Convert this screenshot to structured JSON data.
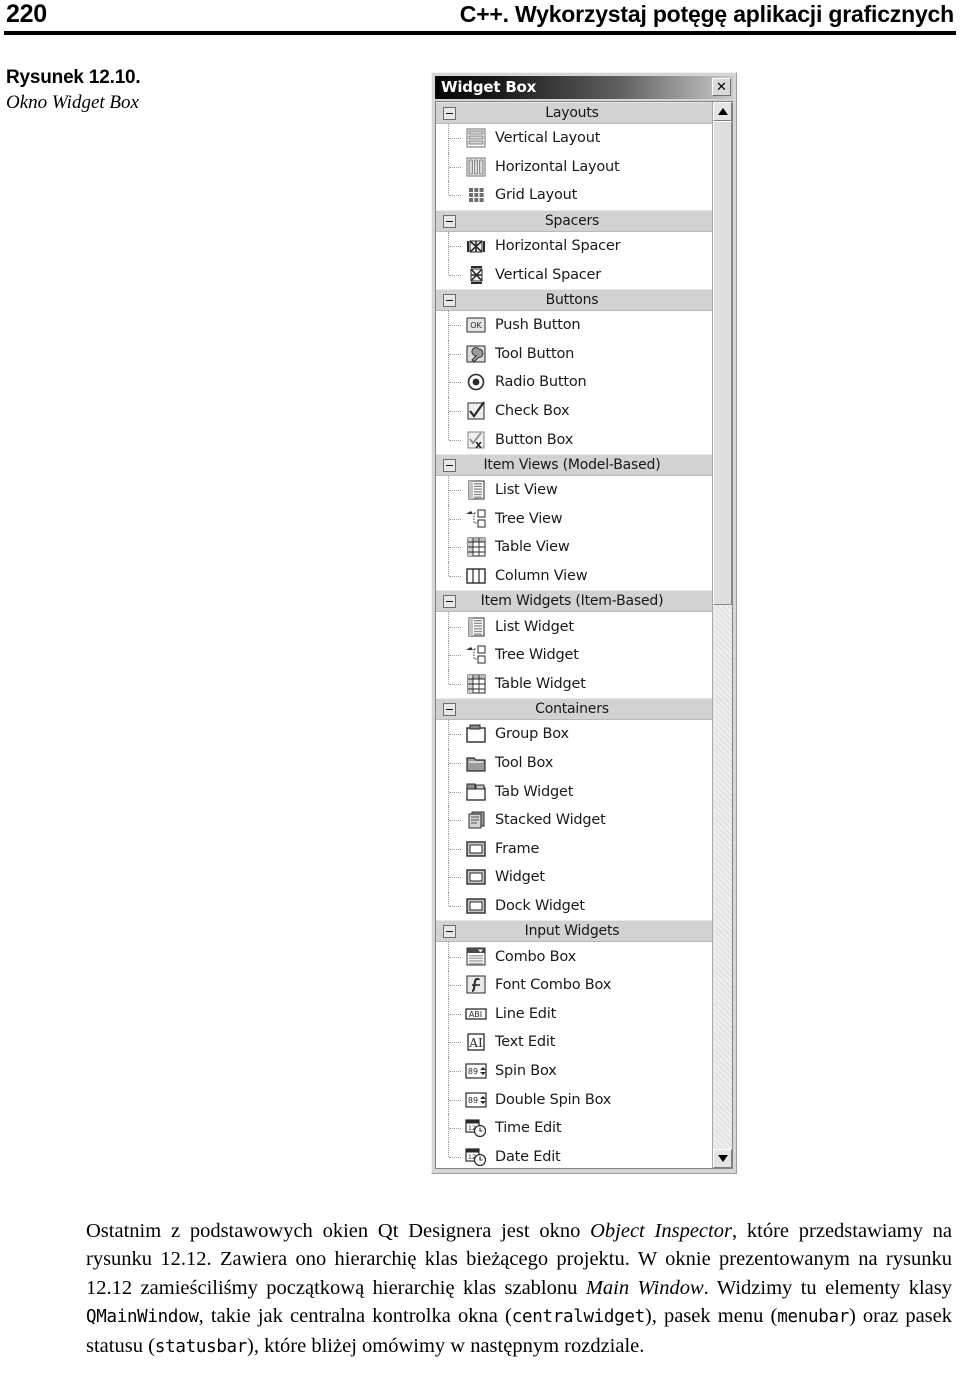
{
  "page": {
    "folio": "220",
    "running_title": "C++. Wykorzystaj potęgę aplikacji graficznych"
  },
  "figure": {
    "number": "Rysunek 12.10.",
    "title": "Okno Widget Box"
  },
  "widget_box": {
    "title": "Widget Box",
    "close_label": "✕",
    "scroll": {
      "up_arrow": "▲",
      "down_arrow": "▼"
    },
    "groups": [
      {
        "label": "Layouts",
        "expanded": true,
        "items": [
          {
            "label": "Vertical Layout",
            "icon": "vertical-layout-icon"
          },
          {
            "label": "Horizontal Layout",
            "icon": "horizontal-layout-icon"
          },
          {
            "label": "Grid Layout",
            "icon": "grid-layout-icon"
          }
        ]
      },
      {
        "label": "Spacers",
        "expanded": true,
        "items": [
          {
            "label": "Horizontal Spacer",
            "icon": "horizontal-spacer-icon"
          },
          {
            "label": "Vertical Spacer",
            "icon": "vertical-spacer-icon"
          }
        ]
      },
      {
        "label": "Buttons",
        "expanded": true,
        "items": [
          {
            "label": "Push Button",
            "icon": "push-button-icon"
          },
          {
            "label": "Tool Button",
            "icon": "tool-button-icon"
          },
          {
            "label": "Radio Button",
            "icon": "radio-button-icon"
          },
          {
            "label": "Check Box",
            "icon": "check-box-icon"
          },
          {
            "label": "Button Box",
            "icon": "button-box-icon"
          }
        ]
      },
      {
        "label": "Item Views (Model-Based)",
        "expanded": true,
        "items": [
          {
            "label": "List View",
            "icon": "list-view-icon"
          },
          {
            "label": "Tree View",
            "icon": "tree-view-icon"
          },
          {
            "label": "Table View",
            "icon": "table-view-icon"
          },
          {
            "label": "Column View",
            "icon": "column-view-icon"
          }
        ]
      },
      {
        "label": "Item Widgets (Item-Based)",
        "expanded": true,
        "items": [
          {
            "label": "List Widget",
            "icon": "list-widget-icon"
          },
          {
            "label": "Tree Widget",
            "icon": "tree-widget-icon"
          },
          {
            "label": "Table Widget",
            "icon": "table-widget-icon"
          }
        ]
      },
      {
        "label": "Containers",
        "expanded": true,
        "items": [
          {
            "label": "Group Box",
            "icon": "group-box-icon"
          },
          {
            "label": "Tool Box",
            "icon": "tool-box-icon"
          },
          {
            "label": "Tab Widget",
            "icon": "tab-widget-icon"
          },
          {
            "label": "Stacked Widget",
            "icon": "stacked-widget-icon"
          },
          {
            "label": "Frame",
            "icon": "frame-icon"
          },
          {
            "label": "Widget",
            "icon": "widget-icon"
          },
          {
            "label": "Dock Widget",
            "icon": "dock-widget-icon"
          }
        ]
      },
      {
        "label": "Input Widgets",
        "expanded": true,
        "items": [
          {
            "label": "Combo Box",
            "icon": "combo-box-icon"
          },
          {
            "label": "Font Combo Box",
            "icon": "font-combo-box-icon"
          },
          {
            "label": "Line Edit",
            "icon": "line-edit-icon"
          },
          {
            "label": "Text Edit",
            "icon": "text-edit-icon"
          },
          {
            "label": "Spin Box",
            "icon": "spin-box-icon"
          },
          {
            "label": "Double Spin Box",
            "icon": "double-spin-box-icon"
          },
          {
            "label": "Time Edit",
            "icon": "time-edit-icon"
          },
          {
            "label": "Date Edit",
            "icon": "date-edit-icon"
          }
        ]
      }
    ]
  },
  "body": {
    "p1_a": "Ostatnim z podstawowych okien Qt Designera jest okno ",
    "p1_em1": "Object Inspector",
    "p1_b": ", które przedstawiamy na rysunku 12.12. Zawiera ono hierarchię klas bieżącego projektu. W oknie prezentowanym na rysunku 12.12 zamieściliśmy początkową hierarchię klas szablonu ",
    "p1_em2": "Main Window",
    "p1_c": ". Widzimy tu elementy klasy ",
    "p1_code1": "QMainWindow",
    "p1_d": ", takie jak centralna kontrolka okna (",
    "p1_code2": "centralwidget",
    "p1_e": "), pasek menu (",
    "p1_code3": "menubar",
    "p1_f": ") oraz pasek statusu (",
    "p1_code4": "statusbar",
    "p1_g": "), które bliżej omówimy w następnym rozdziale."
  },
  "colors": {
    "titlebar_dark": "#050505",
    "titlebar_light": "#c9c9c9",
    "group_header_bg": "#d2d2d2",
    "window_bg": "#d6d6d6",
    "tree_bg": "#ffffff"
  }
}
